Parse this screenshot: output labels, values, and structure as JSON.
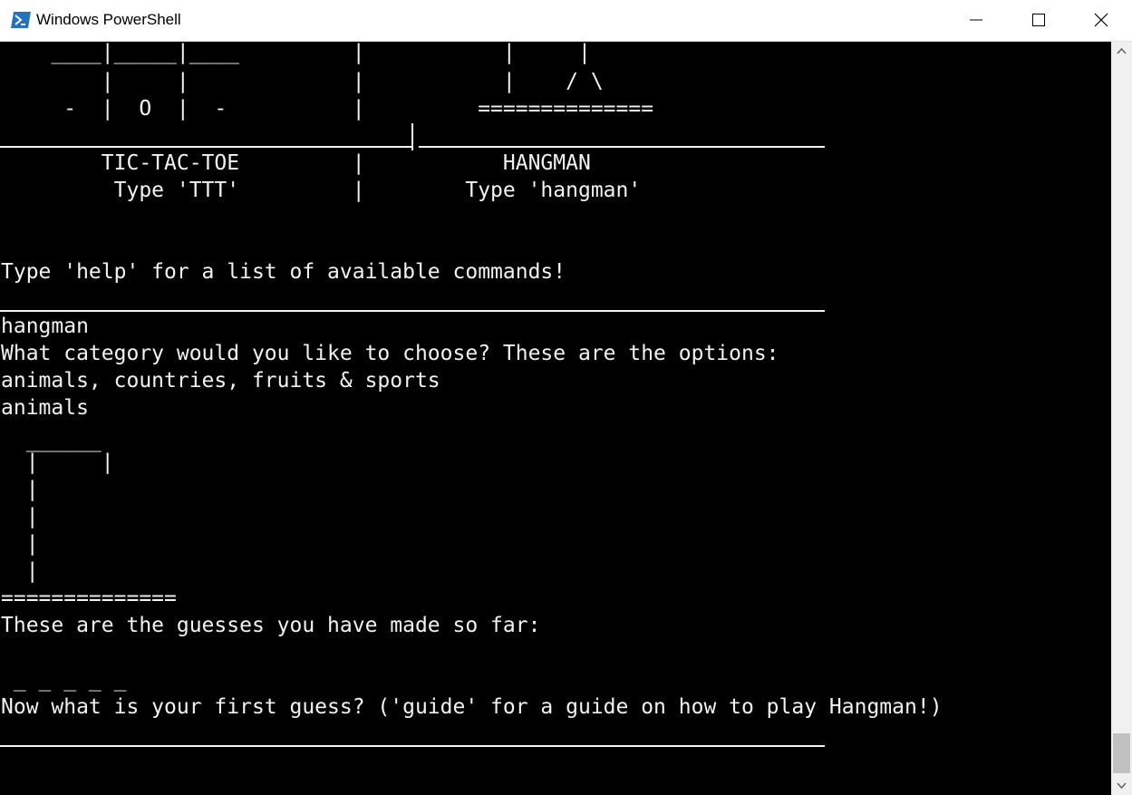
{
  "window": {
    "title": "Windows PowerShell",
    "icon": "powershell-icon",
    "controls": [
      "minimize-icon",
      "maximize-icon",
      "close-icon"
    ]
  },
  "console": {
    "menu_art": [
      "    ____|_____|____         |           |     |",
      "        |     |             |           |    / \\",
      "     -  |  O  |  -          |         ==============",
      "                            ",
      "        TIC-TAC-TOE         |           HANGMAN",
      "         Type 'TTT'         |        Type 'hangman'"
    ],
    "help_hint": "Type 'help' for a list of available commands!",
    "command": "hangman",
    "category_prompt": "What category would you like to choose? These are the options:",
    "category_options": "animals, countries, fruits & sports",
    "category_input": "animals",
    "gallows": [
      "  ______",
      "  |     |",
      "  |",
      "  |",
      "  |",
      "  |",
      "=============="
    ],
    "guesses_label": "These are the guesses you have made so far:",
    "word_blanks": " _ _ _ _ _",
    "guess_prompt": "Now what is your first guess? ('guide' for a guide on how to play Hangman!)"
  },
  "colors": {
    "console_bg": "#000000",
    "console_fg": "#f2f2f2",
    "titlebar_bg": "#ffffff",
    "scrollbar_bg": "#f0f0f0"
  }
}
